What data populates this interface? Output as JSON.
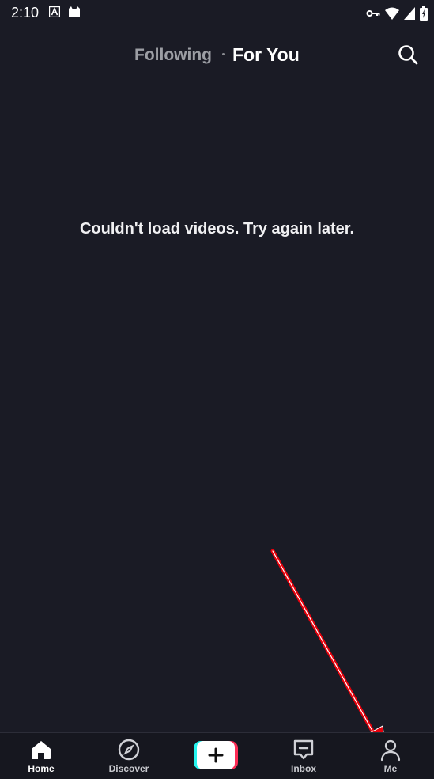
{
  "status_bar": {
    "time": "2:10",
    "left_icons": [
      "font-a-icon",
      "cat-notification-icon"
    ],
    "right_icons": [
      "vpn-key-icon",
      "wifi-icon",
      "signal-icon",
      "battery-icon"
    ]
  },
  "top_tabs": {
    "following": "Following",
    "for_you": "For You",
    "active": "For You",
    "search_icon": "search-icon"
  },
  "main": {
    "error_message": "Couldn't load videos. Try again later."
  },
  "bottom_nav": {
    "items": [
      {
        "label": "Home",
        "icon": "home-icon",
        "active": true
      },
      {
        "label": "Discover",
        "icon": "compass-icon",
        "active": false
      },
      {
        "label": "",
        "icon": "plus-icon",
        "active": false
      },
      {
        "label": "Inbox",
        "icon": "inbox-icon",
        "active": false
      },
      {
        "label": "Me",
        "icon": "person-icon",
        "active": false
      }
    ]
  },
  "colors": {
    "background": "#1a1b25",
    "nav_background": "#16171f",
    "inactive_tab": "#9c9ea4",
    "cyan_accent": "#25f4ee",
    "red_accent": "#fe2c55",
    "annotation_arrow": "#e8000b"
  }
}
